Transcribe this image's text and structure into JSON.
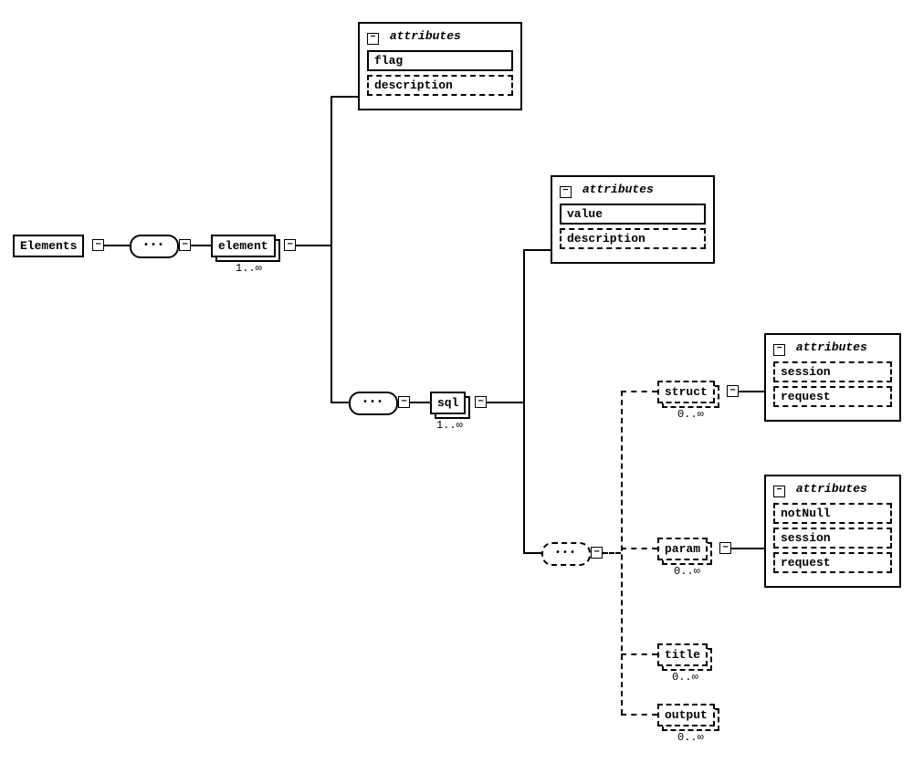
{
  "root": {
    "label": "Elements"
  },
  "element": {
    "label": "element",
    "cardinality": "1..∞"
  },
  "element_attrs": {
    "title": "attributes",
    "items": [
      {
        "name": "flag",
        "required": true
      },
      {
        "name": "description",
        "required": false
      }
    ]
  },
  "sql": {
    "label": "sql",
    "cardinality": "1..∞"
  },
  "sql_attrs": {
    "title": "attributes",
    "items": [
      {
        "name": "value",
        "required": true
      },
      {
        "name": "description",
        "required": false
      }
    ]
  },
  "struct": {
    "label": "struct",
    "cardinality": "0..∞"
  },
  "struct_attrs": {
    "title": "attributes",
    "items": [
      {
        "name": "session",
        "required": false
      },
      {
        "name": "request",
        "required": false
      }
    ]
  },
  "param": {
    "label": "param",
    "cardinality": "0..∞"
  },
  "param_attrs": {
    "title": "attributes",
    "items": [
      {
        "name": "notNull",
        "required": false
      },
      {
        "name": "session",
        "required": false
      },
      {
        "name": "request",
        "required": false
      }
    ]
  },
  "title_node": {
    "label": "title",
    "cardinality": "0..∞"
  },
  "output_node": {
    "label": "output",
    "cardinality": "0..∞"
  },
  "glyphs": {
    "minus": "−"
  }
}
